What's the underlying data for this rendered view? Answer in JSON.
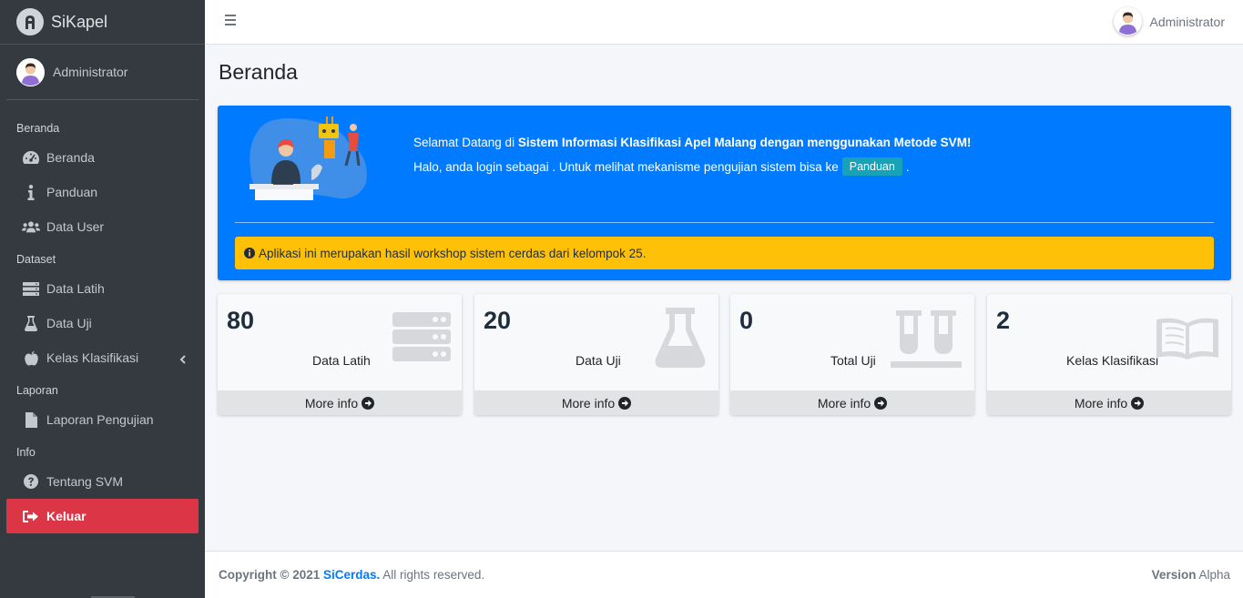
{
  "brand": {
    "name": "SiKapel"
  },
  "sidebar": {
    "user_name": "Administrator",
    "sections": [
      {
        "header": "Beranda",
        "items": [
          {
            "label": "Beranda",
            "icon": "dashboard-icon"
          },
          {
            "label": "Panduan",
            "icon": "info-icon"
          },
          {
            "label": "Data User",
            "icon": "users-icon"
          }
        ]
      },
      {
        "header": "Dataset",
        "items": [
          {
            "label": "Data Latih",
            "icon": "server-icon"
          },
          {
            "label": "Data Uji",
            "icon": "flask-icon"
          },
          {
            "label": "Kelas Klasifikasi",
            "icon": "apple-icon"
          }
        ]
      },
      {
        "header": "Laporan",
        "items": [
          {
            "label": "Laporan Pengujian",
            "icon": "file-icon"
          }
        ]
      },
      {
        "header": "Info",
        "items": [
          {
            "label": "Tentang SVM",
            "icon": "question-icon"
          },
          {
            "label": "Keluar",
            "icon": "sign-out-icon"
          }
        ]
      }
    ]
  },
  "topbar": {
    "user_name": "Administrator"
  },
  "page": {
    "title": "Beranda"
  },
  "welcome": {
    "greeting_prefix": "Selamat Datang di ",
    "greeting_bold": "Sistem Informasi Klasifikasi Apel Malang dengan menggunakan Metode SVM!",
    "login_text": "Halo, anda login sebagai . Untuk melihat mekanisme pengujian sistem bisa ke",
    "panduan_button": "Panduan",
    "login_suffix": ".",
    "alert_text": "Aplikasi ini merupakan hasil workshop sistem cerdas dari kelompok 25."
  },
  "stats": [
    {
      "value": "80",
      "label": "Data Latih",
      "footer": "More info",
      "icon": "server-icon"
    },
    {
      "value": "20",
      "label": "Data Uji",
      "footer": "More info",
      "icon": "flask-icon"
    },
    {
      "value": "0",
      "label": "Total Uji",
      "footer": "More info",
      "icon": "vials-icon"
    },
    {
      "value": "2",
      "label": "Kelas Klasifikasi",
      "footer": "More info",
      "icon": "book-open-icon"
    }
  ],
  "footer": {
    "copyright": "Copyright © 2021",
    "brand": "SiCerdas.",
    "rights": "All rights reserved.",
    "version_label": "Version",
    "version_value": "Alpha"
  },
  "colors": {
    "sidebar_bg": "#343a40",
    "primary": "#007bff",
    "warning": "#ffc107",
    "danger": "#dc3545",
    "info": "#17a2b8"
  }
}
